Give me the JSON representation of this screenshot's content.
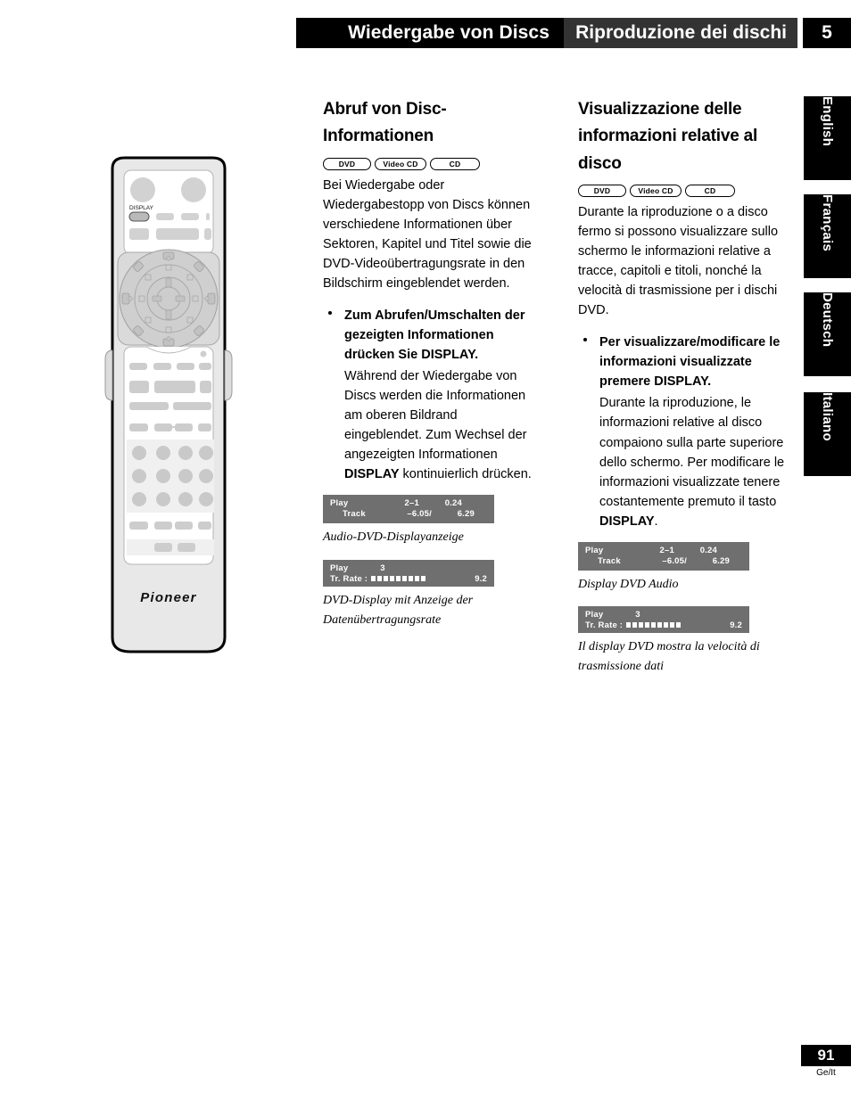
{
  "header": {
    "german_title": "Wiedergabe von Discs",
    "italian_title": "Riproduzione dei dischi",
    "chapter_number": "5"
  },
  "language_tabs": [
    {
      "label": "English"
    },
    {
      "label": "Français"
    },
    {
      "label": "Deutsch"
    },
    {
      "label": "Italiano"
    }
  ],
  "remote": {
    "display_button_label": "DISPLAY",
    "brand": "Pioneer"
  },
  "german_column": {
    "title": "Abruf von Disc-Informationen",
    "badges": [
      {
        "label": "DVD"
      },
      {
        "label": "Video CD"
      },
      {
        "label": "CD"
      }
    ],
    "intro": "Bei Wiedergabe oder Wiedergabestopp von Discs können verschiedene Informationen über Sektoren, Kapitel und Titel sowie die DVD-Videoübertragungsrate in den Bildschirm eingeblendet werden.",
    "bullet_heading": "Zum Abrufen/Umschalten der gezeigten Informationen drücken Sie DISPLAY.",
    "bullet_body_before": "Während der Wiedergabe von Discs werden die Informationen am oberen Bildrand eingeblendet. Zum Wechsel der angezeigten Informationen ",
    "bullet_body_bold": "DISPLAY",
    "bullet_body_after": " kontinuierlich drücken.",
    "caption_1": "Audio-DVD-Displayanzeige",
    "caption_2": "DVD-Display mit Anzeige der Datenübertragungsrate"
  },
  "italian_column": {
    "title": "Visualizzazione delle informazioni relative al disco",
    "badges": [
      {
        "label": "DVD"
      },
      {
        "label": "Video CD"
      },
      {
        "label": "CD"
      }
    ],
    "intro": "Durante la riproduzione o a disco fermo si possono visualizzare sullo schermo le informazioni relative a tracce, capitoli e titoli, nonché la velocità di trasmissione per i dischi DVD.",
    "bullet_heading": "Per visualizzare/modificare le informazioni visualizzate premere DISPLAY.",
    "bullet_body_before": "Durante la riproduzione, le informazioni relative al disco compaiono sulla parte superiore dello schermo. Per modificare le informazioni visualizzate tenere costantemente premuto il tasto ",
    "bullet_body_bold": "DISPLAY",
    "bullet_body_after": ".",
    "caption_1": "Display DVD Audio",
    "caption_2": "Il display DVD mostra la velocità di trasmissione dati"
  },
  "osd_audio": {
    "status": "Play",
    "track_label": "Track",
    "col1_top": "2–1",
    "col2_top": "0.24",
    "col1_bottom": "–6.05/",
    "col2_bottom": "6.29"
  },
  "osd_rate": {
    "status": "Play",
    "title_number": "3",
    "rate_label": "Tr. Rate :",
    "rate_value": "9.2",
    "rate_blocks": 9
  },
  "footer": {
    "page_number": "91",
    "page_code": "Ge/It"
  },
  "colors": {
    "header_black": "#000000",
    "header_gray": "#333333",
    "osd_gray": "#6f6f6f",
    "remote_body": "#e8e8e8",
    "remote_button": "#c9c9c9"
  }
}
